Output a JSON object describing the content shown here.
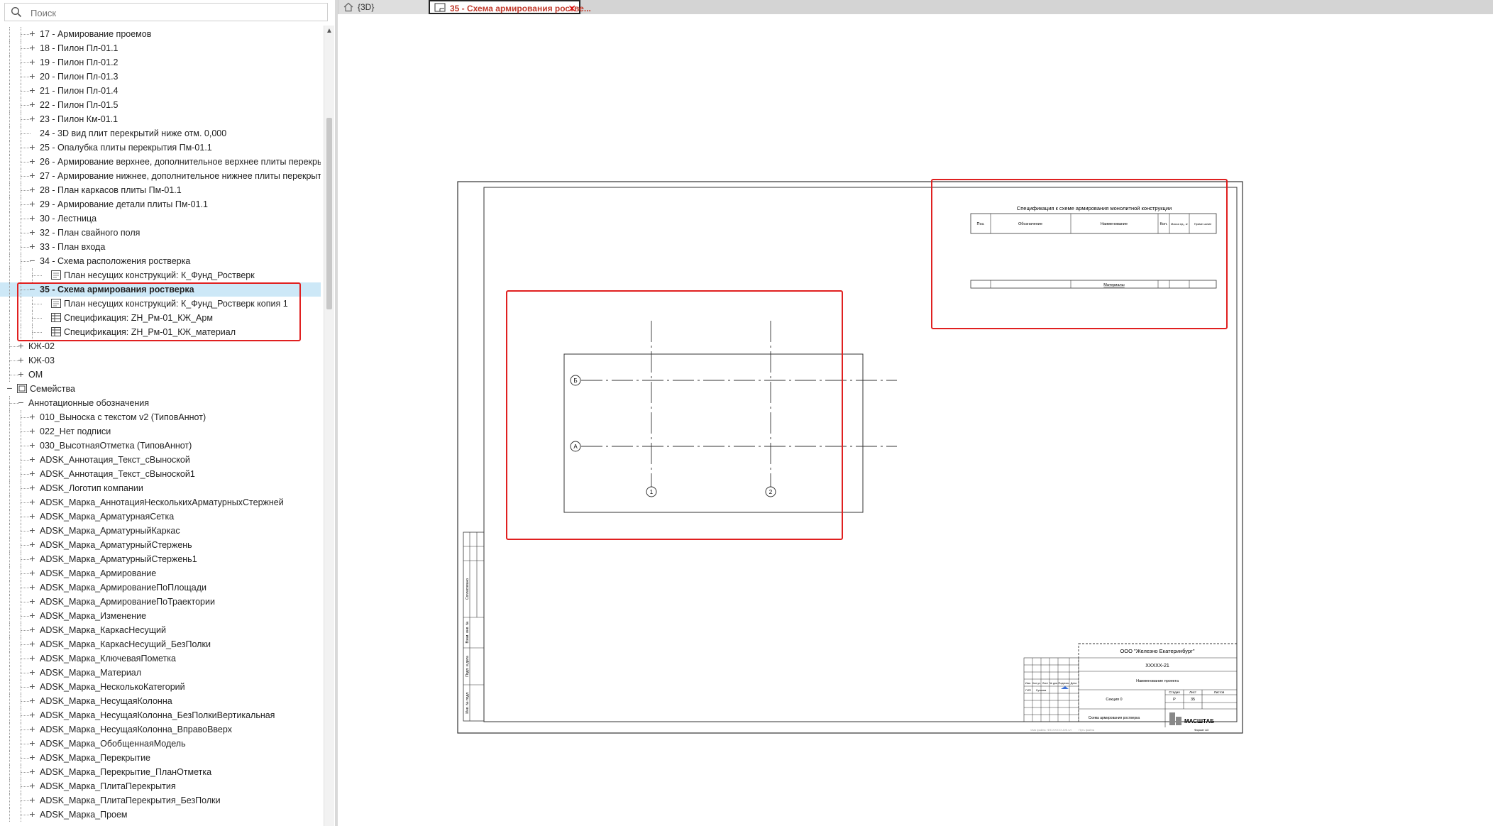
{
  "search": {
    "placeholder": "Поиск"
  },
  "tabs": {
    "tab_3d": "{3D}",
    "tab_active": "35 - Схема армирования ростве..."
  },
  "tree": [
    {
      "depth": 2,
      "pm": "+",
      "label": "17 - Армирование проемов"
    },
    {
      "depth": 2,
      "pm": "+",
      "label": "18 - Пилон Пл-01.1"
    },
    {
      "depth": 2,
      "pm": "+",
      "label": "19 - Пилон Пл-01.2"
    },
    {
      "depth": 2,
      "pm": "+",
      "label": "20 - Пилон Пл-01.3"
    },
    {
      "depth": 2,
      "pm": "+",
      "label": "21 - Пилон Пл-01.4"
    },
    {
      "depth": 2,
      "pm": "+",
      "label": "22 - Пилон Пл-01.5"
    },
    {
      "depth": 2,
      "pm": "+",
      "label": "23 - Пилон Км-01.1"
    },
    {
      "depth": 2,
      "pm": "",
      "label": "24 - 3D вид плит перекрытий ниже отм. 0,000"
    },
    {
      "depth": 2,
      "pm": "+",
      "label": "25 - Опалубка плиты перекрытия Пм-01.1"
    },
    {
      "depth": 2,
      "pm": "+",
      "label": "26 - Армирование верхнее, дополнительное верхнее плиты перекрытия"
    },
    {
      "depth": 2,
      "pm": "+",
      "label": "27 - Армирование нижнее, дополнительное нижнее плиты перекрытия"
    },
    {
      "depth": 2,
      "pm": "+",
      "label": "28 - План каркасов плиты Пм-01.1"
    },
    {
      "depth": 2,
      "pm": "+",
      "label": "29 - Армирование детали плиты Пм-01.1"
    },
    {
      "depth": 2,
      "pm": "+",
      "label": "30 - Лестница"
    },
    {
      "depth": 2,
      "pm": "+",
      "label": "32 - План свайного поля"
    },
    {
      "depth": 2,
      "pm": "+",
      "label": "33 - План входа"
    },
    {
      "depth": 2,
      "pm": "−",
      "label": "34 - Схема расположения ростверка"
    },
    {
      "depth": 3,
      "pm": "",
      "icon": "view",
      "label": "План несущих конструкций: К_Фунд_Ростверк"
    },
    {
      "depth": 2,
      "pm": "−",
      "label": "35 - Схема армирования ростверка",
      "selected": true
    },
    {
      "depth": 3,
      "pm": "",
      "icon": "view",
      "label": "План несущих конструкций: К_Фунд_Ростверк копия 1"
    },
    {
      "depth": 3,
      "pm": "",
      "icon": "schedule",
      "label": "Спецификация: ZH_Рм-01_КЖ_Арм"
    },
    {
      "depth": 3,
      "pm": "",
      "icon": "schedule",
      "label": "Спецификация: ZH_Рм-01_КЖ_материал"
    },
    {
      "depth": 1,
      "pm": "+",
      "label": "КЖ-02"
    },
    {
      "depth": 1,
      "pm": "+",
      "label": "КЖ-03"
    },
    {
      "depth": 1,
      "pm": "+",
      "label": "ОМ"
    },
    {
      "depth": 0,
      "pm": "−",
      "icon": "family",
      "label": "Семейства"
    },
    {
      "depth": 1,
      "pm": "−",
      "label": "Аннотационные обозначения"
    },
    {
      "depth": 2,
      "pm": "+",
      "label": "010_Выноска с текстом v2 (ТиповАннот)"
    },
    {
      "depth": 2,
      "pm": "+",
      "label": "022_Нет подписи"
    },
    {
      "depth": 2,
      "pm": "+",
      "label": "030_ВысотнаяОтметка (ТиповАннот)"
    },
    {
      "depth": 2,
      "pm": "+",
      "label": "ADSK_Аннотация_Текст_сВыноской"
    },
    {
      "depth": 2,
      "pm": "+",
      "label": "ADSK_Аннотация_Текст_сВыноской1"
    },
    {
      "depth": 2,
      "pm": "+",
      "label": "ADSK_Логотип компании"
    },
    {
      "depth": 2,
      "pm": "+",
      "label": "ADSK_Марка_АннотацияНесколькихАрматурныхСтержней"
    },
    {
      "depth": 2,
      "pm": "+",
      "label": "ADSK_Марка_АрматурнаяСетка"
    },
    {
      "depth": 2,
      "pm": "+",
      "label": "ADSK_Марка_АрматурныйКаркас"
    },
    {
      "depth": 2,
      "pm": "+",
      "label": "ADSK_Марка_АрматурныйСтержень"
    },
    {
      "depth": 2,
      "pm": "+",
      "label": "ADSK_Марка_АрматурныйСтержень1"
    },
    {
      "depth": 2,
      "pm": "+",
      "label": "ADSK_Марка_Армирование"
    },
    {
      "depth": 2,
      "pm": "+",
      "label": "ADSK_Марка_АрмированиеПоПлощади"
    },
    {
      "depth": 2,
      "pm": "+",
      "label": "ADSK_Марка_АрмированиеПоТраектории"
    },
    {
      "depth": 2,
      "pm": "+",
      "label": "ADSK_Марка_Изменение"
    },
    {
      "depth": 2,
      "pm": "+",
      "label": "ADSK_Марка_КаркасНесущий"
    },
    {
      "depth": 2,
      "pm": "+",
      "label": "ADSK_Марка_КаркасНесущий_БезПолки"
    },
    {
      "depth": 2,
      "pm": "+",
      "label": "ADSK_Марка_КлючеваяПометка"
    },
    {
      "depth": 2,
      "pm": "+",
      "label": "ADSK_Марка_Материал"
    },
    {
      "depth": 2,
      "pm": "+",
      "label": "ADSK_Марка_НесколькоКатегорий"
    },
    {
      "depth": 2,
      "pm": "+",
      "label": "ADSK_Марка_НесущаяКолонна"
    },
    {
      "depth": 2,
      "pm": "+",
      "label": "ADSK_Марка_НесущаяКолонна_БезПолкиВертикальная"
    },
    {
      "depth": 2,
      "pm": "+",
      "label": "ADSK_Марка_НесущаяКолонна_ВправоВверх"
    },
    {
      "depth": 2,
      "pm": "+",
      "label": "ADSK_Марка_ОбобщеннаяМодель"
    },
    {
      "depth": 2,
      "pm": "+",
      "label": "ADSK_Марка_Перекрытие"
    },
    {
      "depth": 2,
      "pm": "+",
      "label": "ADSK_Марка_Перекрытие_ПланОтметка"
    },
    {
      "depth": 2,
      "pm": "+",
      "label": "ADSK_Марка_ПлитаПерекрытия"
    },
    {
      "depth": 2,
      "pm": "+",
      "label": "ADSK_Марка_ПлитаПерекрытия_БезПолки"
    },
    {
      "depth": 2,
      "pm": "+",
      "label": "ADSK_Марка_Проем"
    }
  ],
  "sheet": {
    "spec_title": "Спецификация к схеме армирования монолитной конструкции",
    "spec_headers": [
      "Поз.",
      "Обозначение",
      "Наименование",
      "Кол.",
      "Масса ед., кг",
      "Приме-чание"
    ],
    "spec_footer": "Материалы",
    "grid_rows": [
      "Б",
      "А"
    ],
    "grid_cols": [
      "1",
      "2"
    ],
    "side_stamp": [
      "Согласовано",
      "Взам. инв. №",
      "Подп. и дата",
      "Инв. № подл."
    ],
    "title_block": {
      "company": "ООО \"Железно Екатеринбург\"",
      "code": "XXXXX-21",
      "project": "Наименование проекта",
      "section": "Секция 0",
      "drawing": "Схема армирования ростверка",
      "stage_headers": [
        "Стадия",
        "Лист",
        "Листов"
      ],
      "stage": "Р",
      "sheet_no": "35",
      "logo": "МАСШТАБ",
      "format": "Формат А3",
      "change_headers": [
        "Изм.",
        "Кол.уч.",
        "Лист",
        "№ док.",
        "Подпись",
        "Дата"
      ],
      "role1": "ГИП",
      "name1": "Сучкова",
      "footer_left": "Имя файла: ФЗ1ХХХХХ-КЖ.rvt",
      "footer_mid": "Путь файла"
    }
  },
  "colors": {
    "highlight": "#e02020",
    "selection": "#cde8f7",
    "tab_text": "#c0392b"
  }
}
